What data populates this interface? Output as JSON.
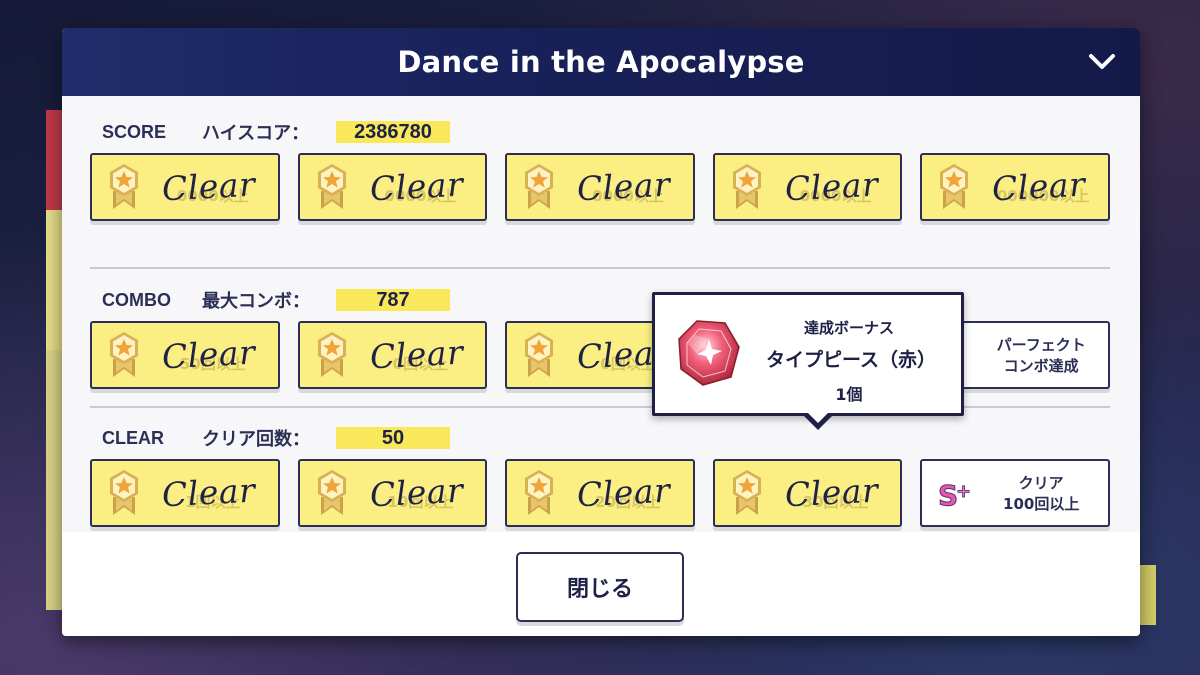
{
  "modal": {
    "title": "Dance in the Apocalypse",
    "close_label": "閉じる"
  },
  "colors": {
    "header": "#18215a",
    "done_card": "#fbef83",
    "value_highlight": "#f8e85a",
    "text_dark": "#1e2045"
  },
  "sections": {
    "score": {
      "key": "SCORE",
      "label": "ハイスコア：",
      "value": "2386780",
      "cards": [
        {
          "status": "Clear",
          "ghost": "0000以上"
        },
        {
          "status": "Clear",
          "ghost": "0000以上"
        },
        {
          "status": "Clear",
          "ghost": "0000以上"
        },
        {
          "status": "Clear",
          "ghost": "0000以上"
        },
        {
          "status": "Clear",
          "ghost": "000000以上"
        }
      ]
    },
    "combo": {
      "key": "COMBO",
      "label": "最大コンボ：",
      "value": "787",
      "cards": [
        {
          "status": "Clear",
          "ghost": "50回以上"
        },
        {
          "status": "Clear",
          "ghost": "0回以上"
        },
        {
          "status": "Clear",
          "ghost": "0回以上"
        }
      ],
      "pending_card": {
        "line1": "パーフェクト",
        "line2": "コンボ達成"
      }
    },
    "clear": {
      "key": "CLEAR",
      "label": "クリア回数：",
      "value": "50",
      "cards": [
        {
          "status": "Clear",
          "ghost": "1回以上"
        },
        {
          "status": "Clear",
          "ghost": "10回以上"
        },
        {
          "status": "Clear",
          "ghost": "20回以上"
        },
        {
          "status": "Clear",
          "ghost": "30回以上"
        }
      ],
      "pending_card": {
        "line1": "クリア",
        "line2": "100回以上",
        "icon": "s-plus-icon"
      }
    }
  },
  "tooltip": {
    "title": "達成ボーナス",
    "item": "タイプピース（赤）",
    "quantity": "1個",
    "icon": "red-gem-icon"
  }
}
